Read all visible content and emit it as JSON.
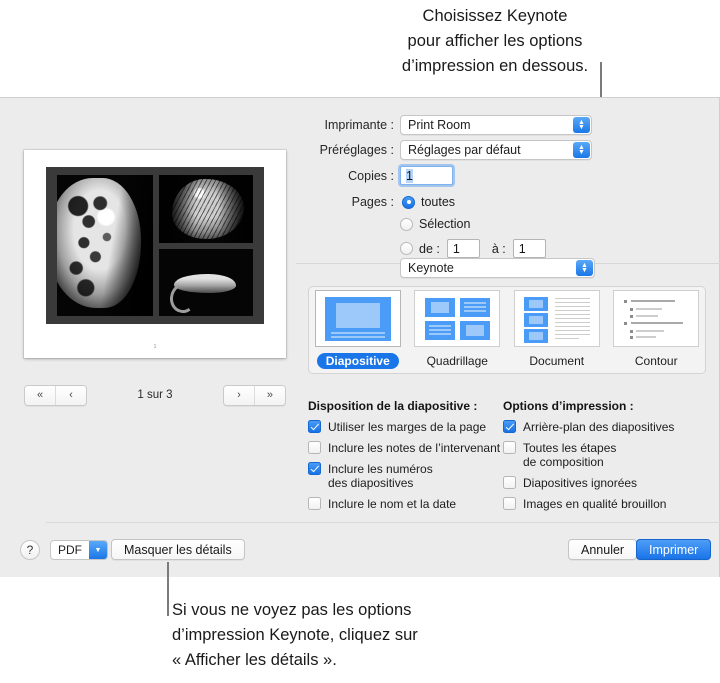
{
  "callouts": {
    "top": "Choisissez Keynote\npour afficher les options\nd’impression en dessous.",
    "bottom": "Si vous ne voyez pas les options\nd’impression Keynote, cliquez sur\n« Afficher les détails »."
  },
  "preview": {
    "page_number_mark": "1",
    "counter": "1 sur 3",
    "nav": {
      "first": "«",
      "previous": "‹",
      "next": "›",
      "last": "»"
    }
  },
  "settings": {
    "printer": {
      "label": "Imprimante :",
      "value": "Print Room"
    },
    "presets": {
      "label": "Préréglages :",
      "value": "Réglages par défaut"
    },
    "copies": {
      "label": "Copies :",
      "value": "1"
    },
    "pages": {
      "label": "Pages :",
      "all": "toutes",
      "selection": "Sélection",
      "from_label": "de :",
      "from_value": "1",
      "to_label": "à :",
      "to_value": "1",
      "selected": "toutes"
    },
    "app_popup": {
      "value": "Keynote"
    }
  },
  "layout_options": [
    {
      "label": "Diapositive",
      "selected": true
    },
    {
      "label": "Quadrillage",
      "selected": false
    },
    {
      "label": "Document",
      "selected": false
    },
    {
      "label": "Contour",
      "selected": false
    }
  ],
  "slide_layout": {
    "title": "Disposition de la diapositive :",
    "items": [
      {
        "label": "Utiliser les marges de la page",
        "checked": true
      },
      {
        "label": "Inclure les notes de l’intervenant",
        "checked": false
      },
      {
        "label": "Inclure les numéros\ndes diapositives",
        "checked": true
      },
      {
        "label": "Inclure le nom et la date",
        "checked": false
      }
    ]
  },
  "print_options": {
    "title": "Options d’impression :",
    "items": [
      {
        "label": "Arrière-plan des diapositives",
        "checked": true
      },
      {
        "label": "Toutes les étapes\nde composition",
        "checked": false
      },
      {
        "label": "Diapositives ignorées",
        "checked": false
      },
      {
        "label": "Images en qualité brouillon",
        "checked": false
      }
    ]
  },
  "bottom_bar": {
    "help": "?",
    "pdf": "PDF",
    "hide_details": "Masquer les détails",
    "cancel": "Annuler",
    "print": "Imprimer"
  },
  "colors": {
    "accent_blue": "#1a76e8",
    "dialog_background": "#ececec",
    "selected_label_blue": "#1a76e8"
  }
}
